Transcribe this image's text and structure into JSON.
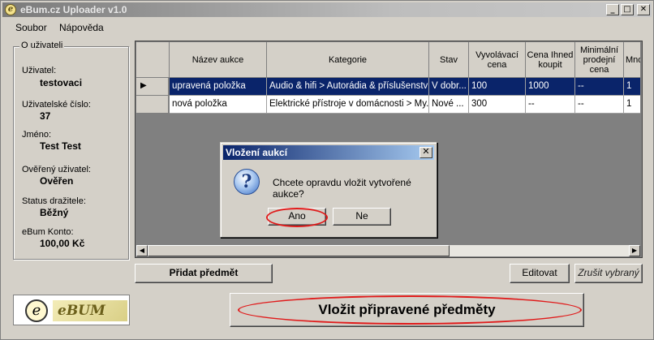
{
  "window": {
    "title": "eBum.cz Uploader v1.0",
    "app_icon_glyph": "e",
    "minimize_glyph": "_",
    "maximize_glyph": "□",
    "close_glyph": "✕"
  },
  "menu": [
    "Soubor",
    "Nápověda"
  ],
  "user_panel": {
    "legend": "O uživateli",
    "fields": [
      {
        "label": "Uživatel:",
        "value": "testovaci"
      },
      {
        "label": "Uživatelské číslo:",
        "value": "37"
      },
      {
        "label": "Jméno:",
        "value": "Test Test"
      },
      {
        "label": "Ověřený uživatel:",
        "value": "Ověřen"
      },
      {
        "label": "Status dražitele:",
        "value": "Běžný"
      },
      {
        "label": "eBum Konto:",
        "value": "100,00 Kč"
      }
    ]
  },
  "table": {
    "columns": [
      "Název aukce",
      "Kategorie",
      "Stav",
      "Vyvolávací cena",
      "Cena Ihned koupit",
      "Minimální prodejní cena",
      "Mno"
    ],
    "rows": [
      [
        "upravená položka",
        "Audio & hifi > Autorádia & příslušenství...",
        "V dobr...",
        "100",
        "1000",
        "--",
        "1"
      ],
      [
        "nová položka",
        "Elektrické přístroje v domácnosti > My...",
        "Nové ...",
        "300",
        "--",
        "--",
        "1"
      ]
    ],
    "selected_row_marker": "▶",
    "scroll_left": "◀",
    "scroll_right": "▶"
  },
  "buttons": {
    "add_item": "Přidat předmět",
    "edit": "Editovat",
    "cancel_selected": "Zrušit vybraný",
    "upload": "Vložit připravené předměty"
  },
  "logo": {
    "glyph": "e",
    "text": "eBUM"
  },
  "dialog": {
    "title": "Vložení aukcí",
    "message": "Chcete opravdu vložit vytvořené aukce?",
    "icon_glyph": "?",
    "yes": "Ano",
    "no": "Ne",
    "close_glyph": "✕"
  },
  "colors": {
    "highlight_oval": "#e01b1b",
    "selection": "#0a246a"
  }
}
